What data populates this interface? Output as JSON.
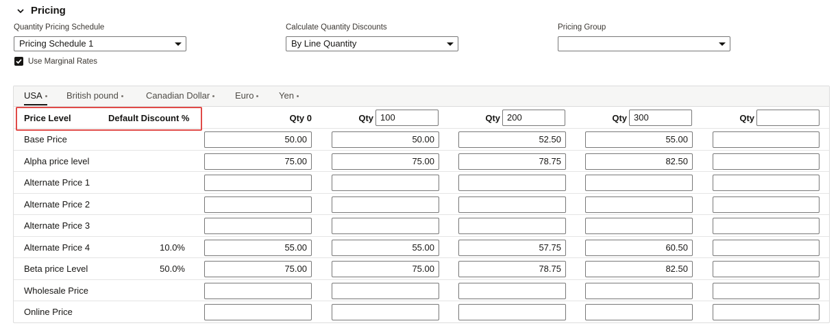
{
  "section": {
    "title": "Pricing",
    "icon": "chevron-down-icon"
  },
  "fields": {
    "quantity_pricing_schedule": {
      "label": "Quantity Pricing Schedule",
      "value": "Pricing Schedule 1"
    },
    "calculate_quantity_discounts": {
      "label": "Calculate Quantity Discounts",
      "value": "By Line Quantity"
    },
    "pricing_group": {
      "label": "Pricing Group",
      "value": ""
    }
  },
  "use_marginal_rates": {
    "label": "Use Marginal Rates",
    "checked": true
  },
  "tabs": [
    {
      "label": "USA",
      "active": true
    },
    {
      "label": "British pound",
      "active": false
    },
    {
      "label": "Canadian Dollar",
      "active": false
    },
    {
      "label": "Euro",
      "active": false
    },
    {
      "label": "Yen",
      "active": false
    }
  ],
  "table": {
    "header": {
      "price_level": "Price Level",
      "default_discount": "Default Discount %",
      "qty_label": "Qty",
      "qty0_label": "Qty 0",
      "qty_values": [
        "100",
        "200",
        "300",
        ""
      ]
    },
    "rows": [
      {
        "label": "Base Price",
        "discount": "",
        "values": [
          "50.00",
          "50.00",
          "52.50",
          "55.00",
          ""
        ]
      },
      {
        "label": "Alpha price level",
        "discount": "",
        "values": [
          "75.00",
          "75.00",
          "78.75",
          "82.50",
          ""
        ]
      },
      {
        "label": "Alternate Price 1",
        "discount": "",
        "values": [
          "",
          "",
          "",
          "",
          ""
        ]
      },
      {
        "label": "Alternate Price 2",
        "discount": "",
        "values": [
          "",
          "",
          "",
          "",
          ""
        ]
      },
      {
        "label": "Alternate Price 3",
        "discount": "",
        "values": [
          "",
          "",
          "",
          "",
          ""
        ]
      },
      {
        "label": "Alternate Price 4",
        "discount": "10.0%",
        "values": [
          "55.00",
          "55.00",
          "57.75",
          "60.50",
          ""
        ]
      },
      {
        "label": "Beta price Level",
        "discount": "50.0%",
        "values": [
          "75.00",
          "75.00",
          "78.75",
          "82.50",
          ""
        ]
      },
      {
        "label": "Wholesale Price",
        "discount": "",
        "values": [
          "",
          "",
          "",
          "",
          ""
        ]
      },
      {
        "label": "Online Price",
        "discount": "",
        "values": [
          "",
          "",
          "",
          "",
          ""
        ]
      }
    ]
  },
  "colors": {
    "highlight": "#e04a47",
    "tab_bar": "#f6f6f5",
    "text": "#161513"
  }
}
